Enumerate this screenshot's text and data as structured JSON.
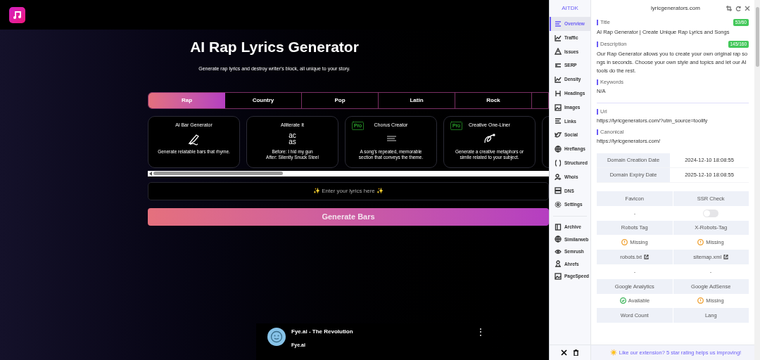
{
  "page": {
    "title": "AI Rap Lyrics Generator",
    "subtitle": "Generate rap lyrics and destroy writer's block, all unique to your story.",
    "tabs": [
      {
        "label": "Rap",
        "selected": true
      },
      {
        "label": "Country",
        "selected": false
      },
      {
        "label": "Pop",
        "selected": false
      },
      {
        "label": "Latin",
        "selected": false
      },
      {
        "label": "Rock",
        "selected": false
      }
    ],
    "cards": [
      {
        "title": "Ai Bar Generator",
        "description": "Generate relatable bars that rhyme."
      },
      {
        "title": "Alliterate It",
        "icon_text": "ac\nas",
        "description": "Before: I hid my gun\nAfter: Silently Snuck Steel"
      },
      {
        "title": "Chorus Creator",
        "pro_label": "Pro",
        "description": "A song's repeated, memorable\nsection that conveys the theme."
      },
      {
        "title": "Creative One-Liner",
        "pro_label": "Pro",
        "description": "Generate a creative metaphors or\nsimile related to your subject."
      }
    ],
    "lyrics_field": {
      "placeholder": "✨ Enter your lyrics here ✨"
    },
    "generate_button": "Generate Bars",
    "video": {
      "title": "Fye.ai - The Revolution",
      "channel": "Fye.ai",
      "menu": "⋮"
    }
  },
  "extension": {
    "brand": "AITDK",
    "domain": "lyricgenerators.com",
    "sidebar": [
      {
        "label": "Overview",
        "selected": true
      },
      {
        "label": "Traffic",
        "selected": false
      },
      {
        "label": "Issues",
        "selected": false
      },
      {
        "label": "SERP",
        "selected": false
      },
      {
        "label": "Density",
        "selected": false
      },
      {
        "label": "Headings",
        "selected": false
      },
      {
        "label": "Images",
        "selected": false
      },
      {
        "label": "Links",
        "selected": false
      },
      {
        "label": "Social",
        "selected": false
      },
      {
        "label": "Hreflangs",
        "selected": false
      },
      {
        "label": "Structured",
        "selected": false
      },
      {
        "label": "Whois",
        "selected": false
      },
      {
        "label": "DNS",
        "selected": false
      },
      {
        "label": "Settings",
        "selected": false
      }
    ],
    "tools": [
      {
        "label": "Archive"
      },
      {
        "label": "Similarweb"
      },
      {
        "label": "Semrush"
      },
      {
        "label": "Ahrefs"
      },
      {
        "label": "PageSpeed"
      }
    ],
    "sections": [
      {
        "label": "Title",
        "badge": "53/60",
        "value": "AI Rap Generator | Create Unique Rap Lyrics and Songs"
      },
      {
        "label": "Description",
        "badge": "145/160",
        "value": "Our Rap Generator allows you to create your own original rap songs in seconds. Choose your own style and topics and let our AI tools do the rest."
      },
      {
        "label": "Keywords",
        "value": "N/A"
      },
      {
        "label": "Url",
        "value": "https://lyricgenerators.com/?utm_source=toolify"
      },
      {
        "label": "Canonical",
        "value": "https://lyricgenerators.com/"
      }
    ],
    "dates": [
      {
        "label": "Domain Creation Date",
        "value": "2024-12-10 18:08:55"
      },
      {
        "label": "Domain Expiry Date",
        "value": "2025-12-10 18:08:55"
      }
    ],
    "grid": [
      {
        "kind": "header",
        "cells": [
          {
            "text": "Favicon"
          },
          {
            "text": "SSR Check"
          }
        ]
      },
      {
        "kind": "values",
        "cells": [
          {
            "kind": "text",
            "text": "-"
          },
          {
            "kind": "toggle",
            "on": false
          }
        ]
      },
      {
        "kind": "header",
        "cells": [
          {
            "text": "Robots Tag"
          },
          {
            "text": "X-Robots-Tag"
          }
        ]
      },
      {
        "kind": "values",
        "cells": [
          {
            "kind": "warning",
            "text": "Missing"
          },
          {
            "kind": "warning",
            "text": "Missing"
          }
        ]
      },
      {
        "kind": "header",
        "cells": [
          {
            "kind": "link",
            "text": "robots.txt"
          },
          {
            "kind": "link",
            "text": "sitemap.xml"
          }
        ]
      },
      {
        "kind": "values",
        "cells": [
          {
            "kind": "text",
            "text": "-"
          },
          {
            "kind": "text",
            "text": "-"
          }
        ]
      },
      {
        "kind": "header",
        "cells": [
          {
            "text": "Google Analytics"
          },
          {
            "text": "Google AdSense"
          }
        ]
      },
      {
        "kind": "values",
        "cells": [
          {
            "kind": "ok",
            "text": "Available"
          },
          {
            "kind": "warning",
            "text": "Missing"
          }
        ]
      },
      {
        "kind": "header",
        "cells": [
          {
            "text": "Word Count"
          },
          {
            "text": "Lang"
          }
        ]
      }
    ],
    "footer": {
      "icon": "☀️",
      "text": "Like our extension? 5 star rating helps us improving!"
    }
  }
}
